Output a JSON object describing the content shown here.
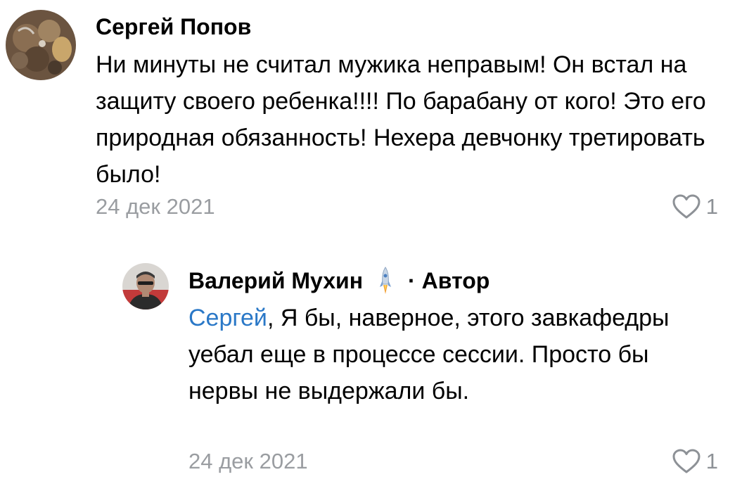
{
  "comments": [
    {
      "author": "Сергей Попов",
      "text": "Ни минуты не считал мужика неправым! Он встал на защиту своего ребенка!!!! По барабану от кого! Это его природная обязанность! Нехера девчонку третировать было!",
      "date": "24 дек 2021",
      "likes": "1"
    },
    {
      "author": "Валерий Мухин",
      "badge_icon": "rocket-icon",
      "author_tag": "· Автор",
      "mention": "Сергей",
      "text": ", Я бы, наверное, этого завкафедры уебал еще в процессе сессии. Просто бы нервы не выдержали бы.",
      "date": "24 дек 2021",
      "likes": "1"
    }
  ],
  "colors": {
    "mention": "#2a78c7",
    "meta": "#9a9da1",
    "icon": "#8d9196"
  }
}
